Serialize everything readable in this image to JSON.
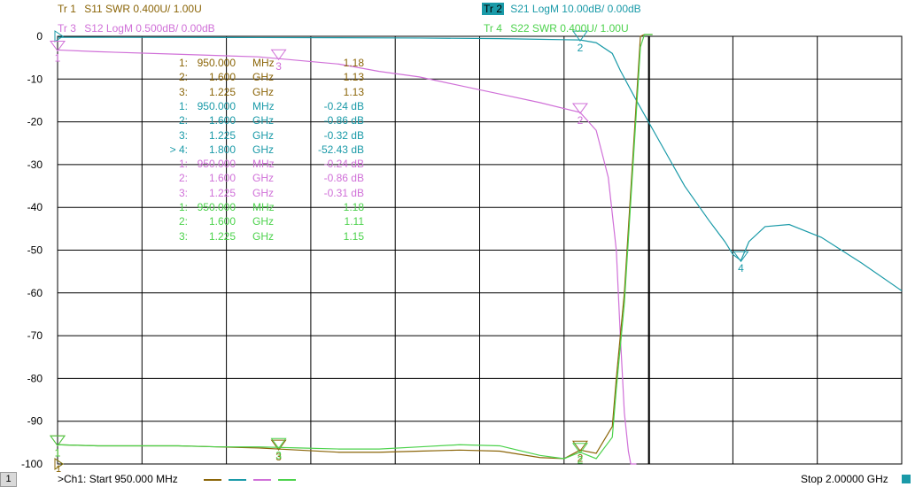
{
  "traces": [
    {
      "id": "tr1",
      "label": "Tr 1",
      "desc": "S11 SWR 0.400U/  1.00U",
      "color": "#8b6508"
    },
    {
      "id": "tr2",
      "label": "Tr 2",
      "desc": "S21 LogM 10.00dB/  0.00dB",
      "color": "#1a9aa8"
    },
    {
      "id": "tr3",
      "label": "Tr 3",
      "desc": "S12 LogM 0.500dB/  0.00dB",
      "color": "#d070d8"
    },
    {
      "id": "tr4",
      "label": "Tr 4",
      "desc": "S22 SWR 0.400U/  1.00U",
      "color": "#4cd24c"
    }
  ],
  "markers": [
    {
      "trace": "tr1",
      "num": "1:",
      "freq": "950.000",
      "unit": "MHz",
      "value": "1.18"
    },
    {
      "trace": "tr1",
      "num": "2:",
      "freq": "1.600",
      "unit": "GHz",
      "value": "1.13"
    },
    {
      "trace": "tr1",
      "num": "3:",
      "freq": "1.225",
      "unit": "GHz",
      "value": "1.13"
    },
    {
      "trace": "tr2",
      "num": "1:",
      "freq": "950.000",
      "unit": "MHz",
      "value": "-0.24 dB"
    },
    {
      "trace": "tr2",
      "num": "2:",
      "freq": "1.600",
      "unit": "GHz",
      "value": "-0.86 dB"
    },
    {
      "trace": "tr2",
      "num": "3:",
      "freq": "1.225",
      "unit": "GHz",
      "value": "-0.32 dB"
    },
    {
      "trace": "tr2",
      "num": "> 4:",
      "freq": "1.800",
      "unit": "GHz",
      "value": "-52.43 dB"
    },
    {
      "trace": "tr3",
      "num": "1:",
      "freq": "950.000",
      "unit": "MHz",
      "value": "-0.24 dB"
    },
    {
      "trace": "tr3",
      "num": "2:",
      "freq": "1.600",
      "unit": "GHz",
      "value": "-0.86 dB"
    },
    {
      "trace": "tr3",
      "num": "3:",
      "freq": "1.225",
      "unit": "GHz",
      "value": "-0.31 dB"
    },
    {
      "trace": "tr4",
      "num": "1:",
      "freq": "950.000",
      "unit": "MHz",
      "value": "1.18"
    },
    {
      "trace": "tr4",
      "num": "2:",
      "freq": "1.600",
      "unit": "GHz",
      "value": "1.11"
    },
    {
      "trace": "tr4",
      "num": "3:",
      "freq": "1.225",
      "unit": "GHz",
      "value": "1.15"
    }
  ],
  "footer": {
    "channel_number": "1",
    "start_label": ">Ch1:  Start  950.000 MHz",
    "stop_label": "Stop  2.00000 GHz"
  },
  "chart_data": {
    "type": "line",
    "xlim": [
      0.95,
      2.0
    ],
    "x_unit": "GHz",
    "ylim": [
      -100,
      0
    ],
    "y_ticks": [
      0,
      -10,
      -20,
      -30,
      -40,
      -50,
      -60,
      -70,
      -80,
      -90,
      -100
    ],
    "y_tick_labels": [
      "0",
      "-10",
      "-20",
      "-30",
      "-40",
      "-50",
      "-60",
      "-70",
      "-80",
      "-90",
      "-100"
    ],
    "grid": true,
    "reference_marker_label": "1",
    "series": [
      {
        "name": "S21",
        "trace": "tr2",
        "x": [
          0.95,
          1.0,
          1.1,
          1.2,
          1.3,
          1.4,
          1.5,
          1.55,
          1.6,
          1.62,
          1.64,
          1.65,
          1.67,
          1.7,
          1.73,
          1.76,
          1.78,
          1.79,
          1.8,
          1.81,
          1.83,
          1.86,
          1.9,
          1.95,
          2.0
        ],
        "y": [
          -0.24,
          -0.24,
          -0.26,
          -0.3,
          -0.34,
          -0.4,
          -0.55,
          -0.7,
          -0.86,
          -1.5,
          -4,
          -8,
          -15,
          -25,
          -35,
          -43,
          -48,
          -51,
          -52.43,
          -48,
          -44.5,
          -44,
          -47,
          -53,
          -59.5
        ],
        "markers": [
          {
            "label": "2",
            "x": 1.6
          },
          {
            "label": "4",
            "x": 1.8
          }
        ]
      },
      {
        "name": "S12",
        "trace": "tr3",
        "x": [
          0.95,
          1.0,
          1.1,
          1.2,
          1.3,
          1.35,
          1.4,
          1.45,
          1.5,
          1.55,
          1.6,
          1.62,
          1.635,
          1.645,
          1.65,
          1.655,
          1.66,
          1.663,
          1.67
        ],
        "y": [
          -3.2,
          -3.6,
          -4.2,
          -4.8,
          -6.5,
          -8.2,
          -9.5,
          -11.5,
          -13.5,
          -15.5,
          -17.8,
          -22,
          -33,
          -50,
          -70,
          -88,
          -97,
          -100,
          -100
        ],
        "markers": [
          {
            "label": "1",
            "x": 0.95
          },
          {
            "label": "3",
            "x": 1.225
          },
          {
            "label": "2",
            "x": 1.6
          }
        ]
      },
      {
        "name": "S11",
        "trace": "tr1",
        "x": [
          0.95,
          1.0,
          1.05,
          1.1,
          1.15,
          1.2,
          1.25,
          1.3,
          1.35,
          1.4,
          1.45,
          1.5,
          1.55,
          1.58,
          1.6,
          1.62,
          1.64,
          1.645,
          1.655,
          1.665,
          1.675,
          1.68,
          1.685,
          1.69
        ],
        "y": [
          1.18,
          1.17,
          1.17,
          1.17,
          1.16,
          1.15,
          1.13,
          1.11,
          1.11,
          1.12,
          1.13,
          1.12,
          1.06,
          1.05,
          1.13,
          1.1,
          1.35,
          1.8,
          2.6,
          3.8,
          5.0,
          5.6,
          6.0,
          6.2
        ],
        "markers": [
          {
            "label": "1",
            "x": 0.95
          },
          {
            "label": "3",
            "x": 1.225
          },
          {
            "label": "2",
            "x": 1.6
          }
        ]
      },
      {
        "name": "S22",
        "trace": "tr4",
        "x": [
          0.95,
          1.0,
          1.05,
          1.1,
          1.15,
          1.2,
          1.25,
          1.3,
          1.35,
          1.4,
          1.45,
          1.5,
          1.55,
          1.58,
          1.6,
          1.62,
          1.64,
          1.645,
          1.655,
          1.665,
          1.675,
          1.68,
          1.685,
          1.69
        ],
        "y": [
          1.18,
          1.17,
          1.17,
          1.17,
          1.16,
          1.16,
          1.15,
          1.14,
          1.14,
          1.16,
          1.18,
          1.17,
          1.08,
          1.05,
          1.11,
          1.05,
          1.25,
          1.7,
          2.5,
          3.7,
          4.9,
          5.6,
          6.0,
          6.2
        ],
        "markers": [
          {
            "label": "1",
            "x": 0.95
          },
          {
            "label": "3",
            "x": 1.225
          },
          {
            "label": "2",
            "x": 1.6
          }
        ]
      }
    ]
  }
}
